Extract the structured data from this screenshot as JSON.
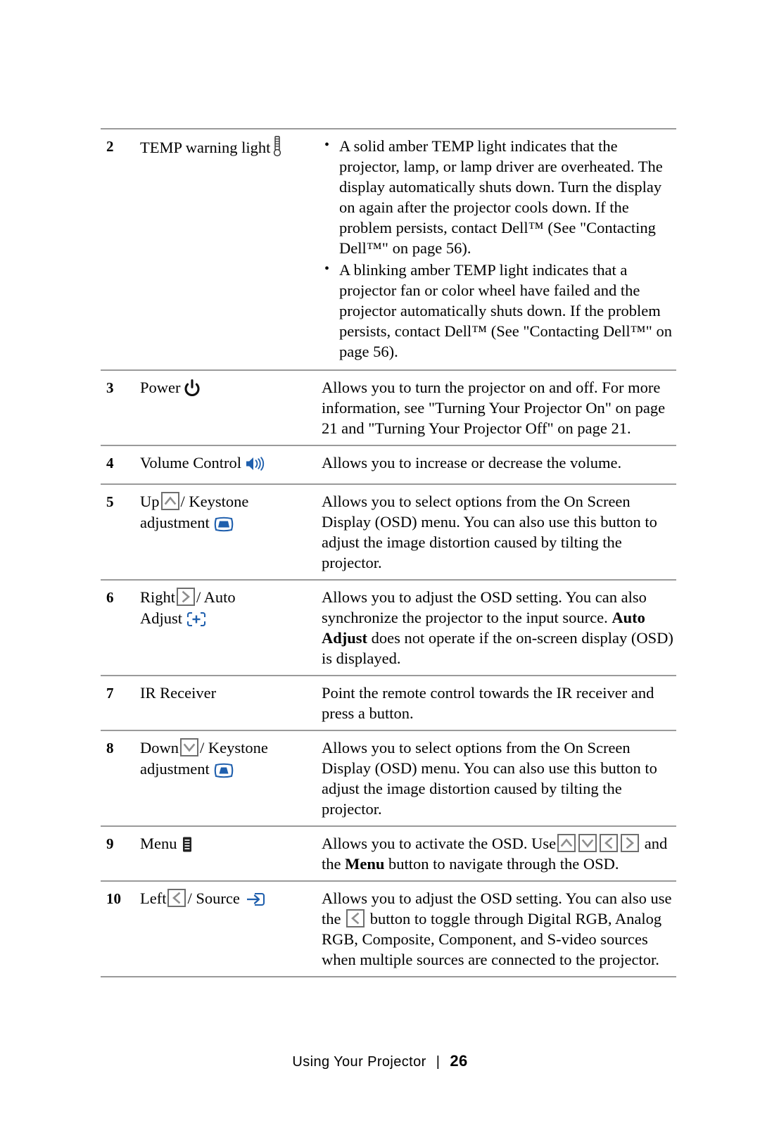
{
  "document": {
    "type": "projector-user-guide-page",
    "footer": {
      "section_label": "Using Your Projector",
      "separator": "|",
      "page_number": "26"
    }
  },
  "colors": {
    "rule": "#9a9a9a",
    "icon_blue": "#1f5fad",
    "icon_gray": "#6e6e6e",
    "text": "#000000"
  },
  "table": {
    "rows": [
      {
        "number": "2",
        "name": "TEMP warning light",
        "icons": [
          "thermometer-icon"
        ],
        "description_bullets": [
          "A solid amber TEMP light indicates that the projector, lamp, or lamp driver are overheated. The display automatically shuts down. Turn the display on again after the projector cools down. If the problem persists, contact Dell™ (See \"Contacting Dell™\" on page 56).",
          "A blinking amber TEMP light indicates that a projector fan or color wheel have failed and the projector automatically shuts down. If the problem persists, contact Dell™ (See \"Contacting Dell™\" on page 56)."
        ]
      },
      {
        "number": "3",
        "name": "Power",
        "icons": [
          "power-icon"
        ],
        "description": "Allows you to turn the projector on and off. For more information, see \"Turning Your Projector On\" on page 21 and \"Turning Your Projector Off\" on page 21."
      },
      {
        "number": "4",
        "name": "Volume Control",
        "icons": [
          "speaker-icon"
        ],
        "description": "Allows you to increase or decrease the volume."
      },
      {
        "number": "5",
        "name_part1": "Up",
        "name_part2": "/ Keystone",
        "name_part3": "adjustment",
        "icons": [
          "up-arrow-key-icon",
          "keystone-up-icon"
        ],
        "description": "Allows you to select options from the On Screen Display (OSD) menu. You can also use this button to adjust the image distortion caused by tilting the projector."
      },
      {
        "number": "6",
        "name_part1": "Right",
        "name_part2": "/ Auto",
        "name_part3": "Adjust",
        "icons": [
          "right-arrow-key-icon",
          "auto-adjust-icon"
        ],
        "description_pre": "Allows you to adjust the OSD setting. You can also synchronize the projector to the input source. ",
        "description_bold": "Auto Adjust",
        "description_post": " does not operate if the on-screen display (OSD) is displayed."
      },
      {
        "number": "7",
        "name": "IR Receiver",
        "icons": [],
        "description": "Point the remote control towards the IR receiver and press a button."
      },
      {
        "number": "8",
        "name_part1": "Down",
        "name_part2": "/ Keystone",
        "name_part3": "adjustment",
        "icons": [
          "down-arrow-key-icon",
          "keystone-down-icon"
        ],
        "description": "Allows you to select options from the On Screen Display (OSD) menu. You can also use this button to adjust the image distortion caused by tilting the projector."
      },
      {
        "number": "9",
        "name": "Menu",
        "icons": [
          "menu-icon"
        ],
        "description_seg1": "Allows you to activate the OSD. Use",
        "description_seg2": "and the",
        "description_bold": "Menu",
        "description_seg3": "button to navigate through the OSD.",
        "inline_icons": [
          "up-arrow-key-icon",
          "down-arrow-key-icon",
          "left-arrow-key-icon",
          "right-arrow-key-icon"
        ]
      },
      {
        "number": "10",
        "name_part1": "Left",
        "name_part2": "/ Source",
        "icons": [
          "left-arrow-key-icon",
          "source-icon"
        ],
        "description_seg1": "Allows you to adjust the OSD setting. You can also use the",
        "description_seg2": "button to toggle through Digital RGB, Analog RGB, Composite, Component, and S-video sources when multiple sources are connected to the projector.",
        "inline_icons": [
          "left-arrow-key-icon"
        ]
      }
    ]
  }
}
